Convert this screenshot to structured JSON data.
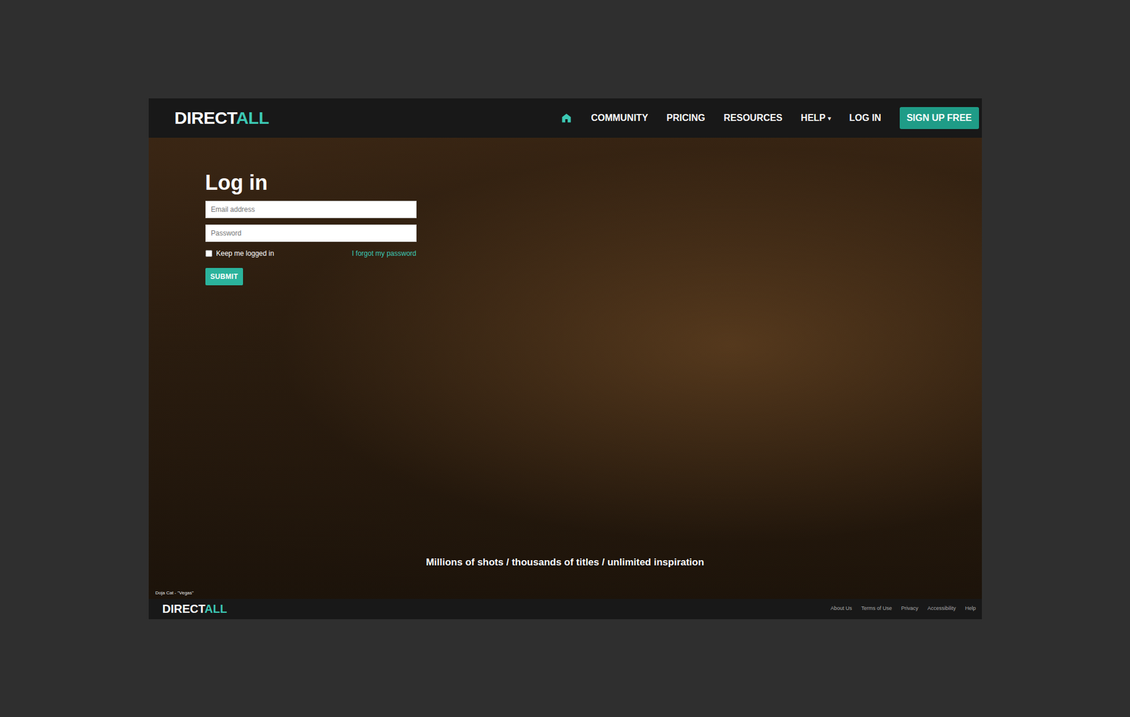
{
  "navbar": {
    "logo": {
      "first": "DIRECT",
      "second": "ALL"
    },
    "items": [
      {
        "kind": "icon",
        "selected": true
      },
      {
        "kind": "link",
        "label": "COMMUNITY",
        "selected": false
      },
      {
        "kind": "link",
        "label": "PRICING",
        "selected": false
      },
      {
        "kind": "link",
        "label": "RESOURCES",
        "selected": false
      },
      {
        "kind": "dropdown",
        "label": "HELP",
        "caret": "▾",
        "selected": false
      },
      {
        "kind": "link",
        "label": "LOG IN",
        "selected": false
      },
      {
        "kind": "button",
        "label": "SIGN UP FREE",
        "selected": false
      }
    ]
  },
  "form": {
    "title": "Log in",
    "email": {
      "placeholder": "Email address"
    },
    "password": {
      "placeholder": "Password"
    },
    "remember": {
      "label": "Keep me logged in",
      "checked": false
    },
    "forgot": "I forgot my password",
    "submit": "SUBMIT"
  },
  "hero": {
    "tagline": "Millions of shots / thousands of titles / unlimited inspiration",
    "caption": "Doja Cat - \"Vegas\""
  },
  "footer": {
    "logo": {
      "first": "DIRECT",
      "second": "ALL"
    },
    "links": [
      "About Us",
      "Terms of Use",
      "Privacy",
      "Accessibility",
      "Help"
    ]
  }
}
